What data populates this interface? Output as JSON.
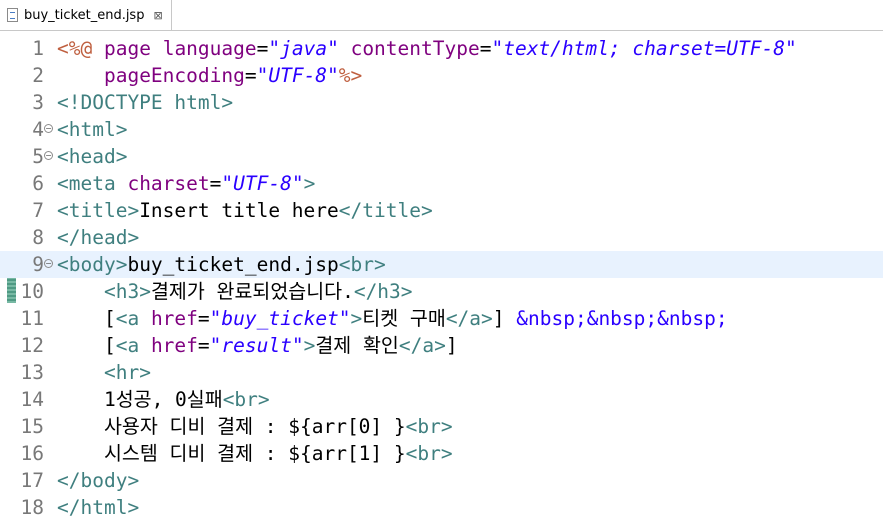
{
  "tab": {
    "title": "buy_ticket_end.jsp",
    "close_glyph": "⊠",
    "icon": "jsp-file-icon"
  },
  "colors": {
    "tag": "#3f7f7f",
    "attribute": "#7f007f",
    "value": "#2a00ff",
    "text": "#000000",
    "jsp_delimiter": "#bf5f3f",
    "entity": "#2a00ff",
    "line_number": "#787878",
    "current_line_bg": "#e8f2fe",
    "change_marker": "#5aa58e"
  },
  "editor": {
    "current_line": 9,
    "lines": [
      {
        "n": "1",
        "fold": false,
        "tokens": [
          {
            "t": "jsp",
            "v": "<%@"
          },
          {
            "t": "txt",
            "v": " "
          },
          {
            "t": "attr",
            "v": "page"
          },
          {
            "t": "txt",
            "v": " "
          },
          {
            "t": "attr",
            "v": "language"
          },
          {
            "t": "txt",
            "v": "="
          },
          {
            "t": "val",
            "v": "\"java\""
          },
          {
            "t": "txt",
            "v": " "
          },
          {
            "t": "attr",
            "v": "contentType"
          },
          {
            "t": "txt",
            "v": "="
          },
          {
            "t": "val",
            "v": "\"text/html; charset=UTF-8\""
          }
        ]
      },
      {
        "n": "2",
        "fold": false,
        "tokens": [
          {
            "t": "txt",
            "v": "    "
          },
          {
            "t": "attr",
            "v": "pageEncoding"
          },
          {
            "t": "txt",
            "v": "="
          },
          {
            "t": "val",
            "v": "\"UTF-8\""
          },
          {
            "t": "jsp",
            "v": "%>"
          }
        ]
      },
      {
        "n": "3",
        "fold": false,
        "tokens": [
          {
            "t": "tag",
            "v": "<!DOCTYPE "
          },
          {
            "t": "tag",
            "v": "html"
          },
          {
            "t": "tag",
            "v": ">"
          }
        ]
      },
      {
        "n": "4",
        "fold": true,
        "tokens": [
          {
            "t": "tag",
            "v": "<html>"
          }
        ]
      },
      {
        "n": "5",
        "fold": true,
        "tokens": [
          {
            "t": "tag",
            "v": "<head>"
          }
        ]
      },
      {
        "n": "6",
        "fold": false,
        "tokens": [
          {
            "t": "tag",
            "v": "<meta"
          },
          {
            "t": "txt",
            "v": " "
          },
          {
            "t": "attr",
            "v": "charset"
          },
          {
            "t": "txt",
            "v": "="
          },
          {
            "t": "val",
            "v": "\"UTF-8\""
          },
          {
            "t": "tag",
            "v": ">"
          }
        ]
      },
      {
        "n": "7",
        "fold": false,
        "tokens": [
          {
            "t": "tag",
            "v": "<title>"
          },
          {
            "t": "txt",
            "v": "Insert title here"
          },
          {
            "t": "tag",
            "v": "</title>"
          }
        ]
      },
      {
        "n": "8",
        "fold": false,
        "tokens": [
          {
            "t": "tag",
            "v": "</head>"
          }
        ]
      },
      {
        "n": "9",
        "fold": true,
        "tokens": [
          {
            "t": "tag",
            "v": "<body>"
          },
          {
            "t": "txt",
            "v": "buy_ticket_end.jsp"
          },
          {
            "t": "tag",
            "v": "<br>"
          }
        ]
      },
      {
        "n": "10",
        "fold": false,
        "tokens": [
          {
            "t": "txt",
            "v": "    "
          },
          {
            "t": "tag",
            "v": "<h3>"
          },
          {
            "t": "txt",
            "v": "결제가 완료되었습니다."
          },
          {
            "t": "tag",
            "v": "</h3>"
          }
        ]
      },
      {
        "n": "11",
        "fold": false,
        "tokens": [
          {
            "t": "txt",
            "v": "    ["
          },
          {
            "t": "tag",
            "v": "<a"
          },
          {
            "t": "txt",
            "v": " "
          },
          {
            "t": "attr",
            "v": "href"
          },
          {
            "t": "txt",
            "v": "="
          },
          {
            "t": "val",
            "v": "\"buy_ticket\""
          },
          {
            "t": "tag",
            "v": ">"
          },
          {
            "t": "txt",
            "v": "티켓 구매"
          },
          {
            "t": "tag",
            "v": "</a>"
          },
          {
            "t": "txt",
            "v": "] "
          },
          {
            "t": "ent",
            "v": "&nbsp;&nbsp;&nbsp;"
          }
        ]
      },
      {
        "n": "12",
        "fold": false,
        "tokens": [
          {
            "t": "txt",
            "v": "    ["
          },
          {
            "t": "tag",
            "v": "<a"
          },
          {
            "t": "txt",
            "v": " "
          },
          {
            "t": "attr",
            "v": "href"
          },
          {
            "t": "txt",
            "v": "="
          },
          {
            "t": "val",
            "v": "\"result\""
          },
          {
            "t": "tag",
            "v": ">"
          },
          {
            "t": "txt",
            "v": "결제 확인"
          },
          {
            "t": "tag",
            "v": "</a>"
          },
          {
            "t": "txt",
            "v": "]"
          }
        ]
      },
      {
        "n": "13",
        "fold": false,
        "tokens": [
          {
            "t": "txt",
            "v": "    "
          },
          {
            "t": "tag",
            "v": "<hr>"
          }
        ]
      },
      {
        "n": "14",
        "fold": false,
        "tokens": [
          {
            "t": "txt",
            "v": "    1성공, 0실패"
          },
          {
            "t": "tag",
            "v": "<br>"
          }
        ]
      },
      {
        "n": "15",
        "fold": false,
        "tokens": [
          {
            "t": "txt",
            "v": "    사용자 디비 결제 : ${arr[0] }"
          },
          {
            "t": "tag",
            "v": "<br>"
          }
        ]
      },
      {
        "n": "16",
        "fold": false,
        "tokens": [
          {
            "t": "txt",
            "v": "    시스템 디비 결제 : ${arr[1] }"
          },
          {
            "t": "tag",
            "v": "<br>"
          }
        ]
      },
      {
        "n": "17",
        "fold": false,
        "tokens": [
          {
            "t": "tag",
            "v": "</body>"
          }
        ]
      },
      {
        "n": "18",
        "fold": false,
        "tokens": [
          {
            "t": "tag",
            "v": "</html>"
          }
        ]
      }
    ]
  }
}
